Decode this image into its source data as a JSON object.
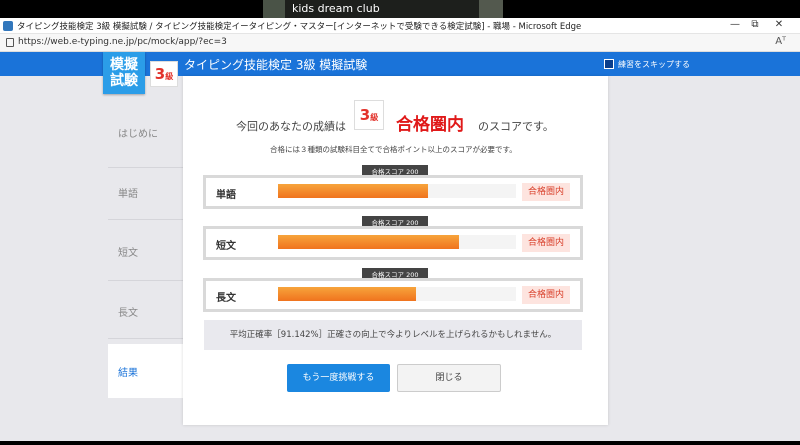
{
  "zoom": {
    "participant_name": "kids dream club"
  },
  "browser": {
    "title": "タイピング技能検定 3級 模擬試験 / タイピング技能検定イータイピング・マスター[インターネットで受験できる検定試験] - 職場 - Microsoft Edge",
    "url": "https://web.e-typing.ne.jp/pc/mock/app/?ec=3",
    "minimize": "—",
    "maximize": "⧉",
    "close": "✕",
    "read_aloud": "Aᵀ"
  },
  "header": {
    "logo_line1": "模擬",
    "logo_line2": "試験",
    "level_num": "3",
    "level_suffix": "級",
    "title": "タイピング技能検定 3級 模擬試験",
    "skip_label": "練習をスキップする"
  },
  "sidebar": {
    "items": [
      {
        "label": "はじめに"
      },
      {
        "label": "単語"
      },
      {
        "label": "短文"
      },
      {
        "label": "長文"
      },
      {
        "label": "結果"
      }
    ]
  },
  "result": {
    "prefix": "今回のあなたの成績は",
    "level_num": "3",
    "level_suffix": "級",
    "status": "合格圏内",
    "suffix": "のスコアです。",
    "note": "合格には３種類の試験科目全てで合格ポイント以上のスコアが必要です。",
    "rows": [
      {
        "label": "単語",
        "tip": "合格スコア 200",
        "badge": "合格圏内",
        "fill_fraction": 0.63
      },
      {
        "label": "短文",
        "tip": "合格スコア 200",
        "badge": "合格圏内",
        "fill_fraction": 0.76
      },
      {
        "label": "長文",
        "tip": "合格スコア 200",
        "badge": "合格圏内",
        "fill_fraction": 0.58
      }
    ],
    "accuracy_text": "平均正確率［91.142%］正確さの向上で今よりレベルを上げられるかもしれません。",
    "retry_label": "もう一度挑戦する",
    "close_label": "閉じる"
  },
  "colors": {
    "brand": "#1a73d9",
    "accent": "#e01919",
    "bar": "#f0731e"
  }
}
